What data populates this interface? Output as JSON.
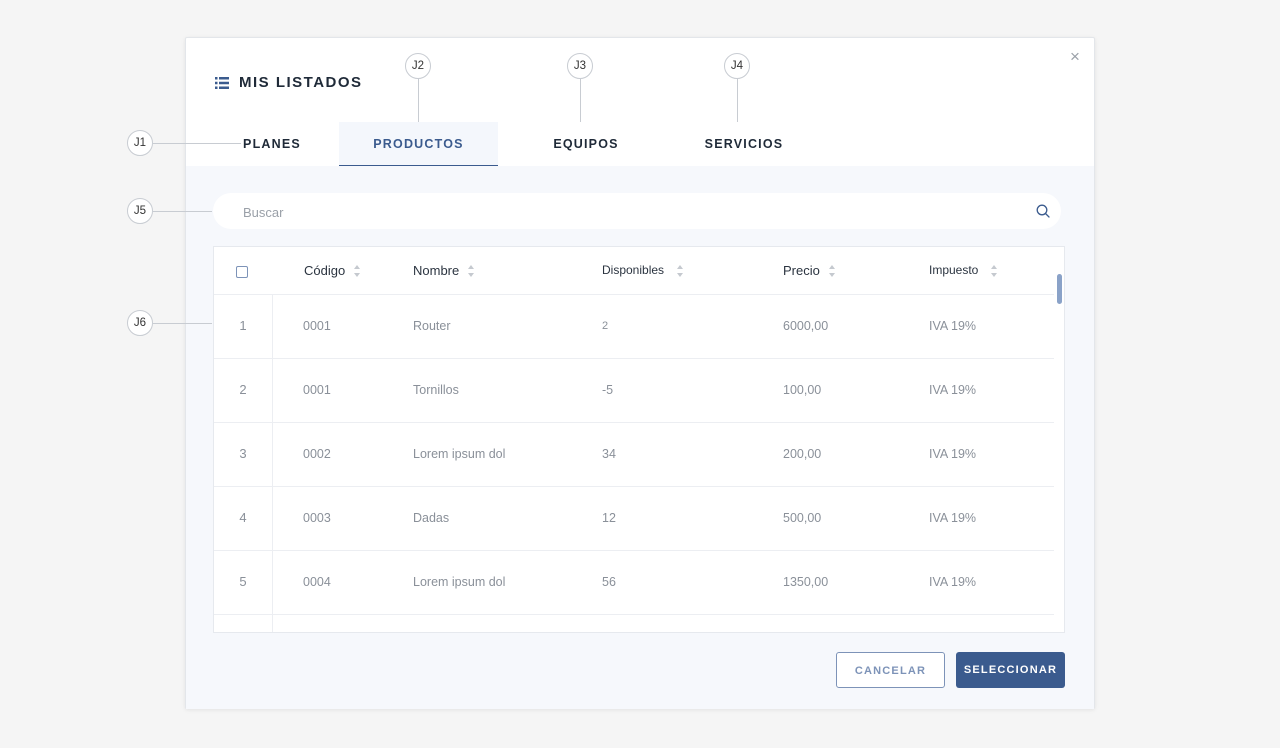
{
  "modal": {
    "title": "MIS LISTADOS",
    "close_label": "×"
  },
  "tabs": [
    {
      "label": "PLANES",
      "active": false
    },
    {
      "label": "PRODUCTOS",
      "active": true
    },
    {
      "label": "EQUIPOS",
      "active": false
    },
    {
      "label": "SERVICIOS",
      "active": false
    }
  ],
  "search": {
    "placeholder": "Buscar",
    "value": ""
  },
  "table": {
    "columns": [
      "Código",
      "Nombre",
      "Disponibles",
      "Precio",
      "Impuesto"
    ],
    "rows": [
      {
        "index": "1",
        "codigo": "0001",
        "nombre": "Router",
        "disponibles": "2",
        "precio": "6000,00",
        "impuesto": "IVA 19%"
      },
      {
        "index": "2",
        "codigo": "0001",
        "nombre": "Tornillos",
        "disponibles": "-5",
        "precio": "100,00",
        "impuesto": "IVA 19%"
      },
      {
        "index": "3",
        "codigo": "0002",
        "nombre": "Lorem ipsum dol",
        "disponibles": "34",
        "precio": "200,00",
        "impuesto": "IVA 19%"
      },
      {
        "index": "4",
        "codigo": "0003",
        "nombre": "Dadas",
        "disponibles": "12",
        "precio": "500,00",
        "impuesto": "IVA 19%"
      },
      {
        "index": "5",
        "codigo": "0004",
        "nombre": "Lorem ipsum dol",
        "disponibles": "56",
        "precio": "1350,00",
        "impuesto": "IVA 19%"
      }
    ]
  },
  "buttons": {
    "cancel": "CANCELAR",
    "select": "SELECCIONAR"
  },
  "callouts": [
    "J1",
    "J2",
    "J3",
    "J4",
    "J5",
    "J6"
  ],
  "colors": {
    "accent": "#3b5b8e",
    "text_dark": "#1f2a38",
    "text_muted": "#8a9099"
  }
}
